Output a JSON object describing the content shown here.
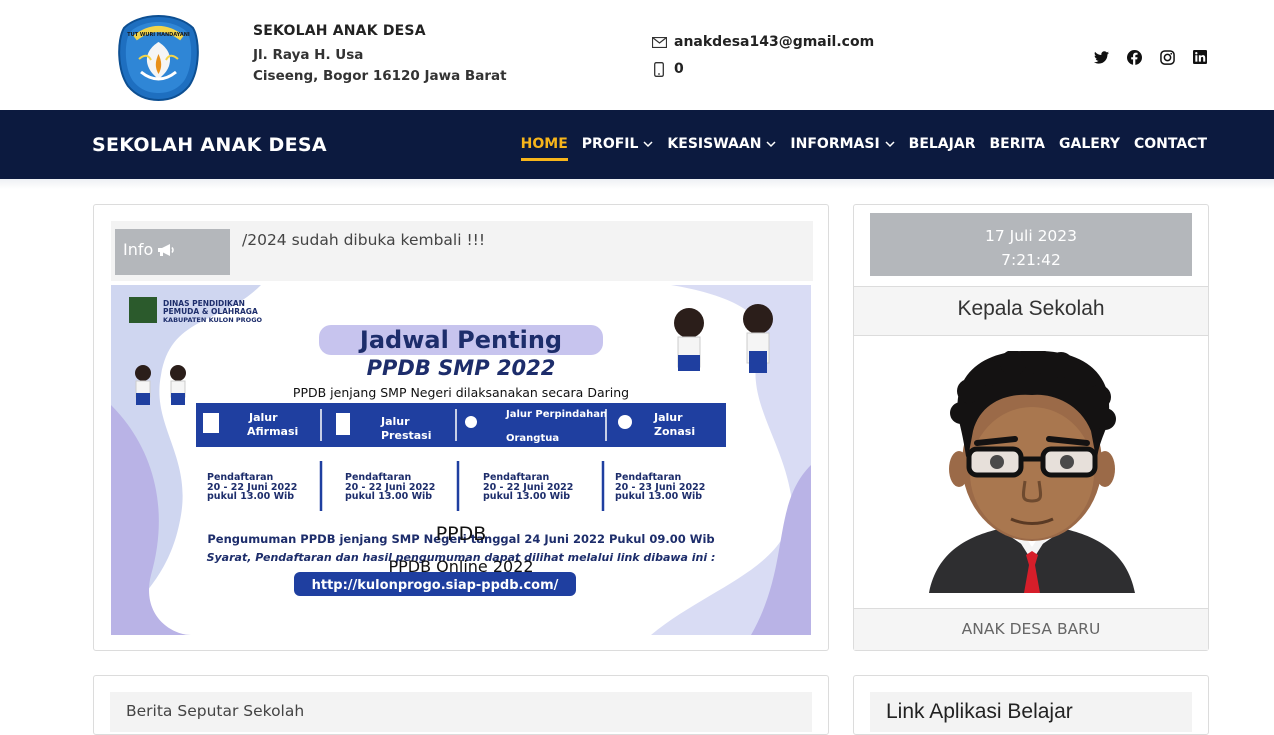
{
  "header": {
    "school_name": "SEKOLAH ANAK DESA",
    "address_line1": "Jl. Raya H. Usa",
    "address_line2": "Ciseeng, Bogor 16120 Jawa Barat",
    "email": "anakdesa143@gmail.com",
    "phone": "0",
    "logo_text": "TUT WURI HANDAYANI",
    "socials": [
      "twitter-icon",
      "facebook-icon",
      "instagram-icon",
      "linkedin-icon"
    ]
  },
  "navbar": {
    "brand": "SEKOLAH ANAK DESA",
    "items": [
      {
        "label": "HOME",
        "active": true,
        "dropdown": false
      },
      {
        "label": "PROFIL",
        "active": false,
        "dropdown": true
      },
      {
        "label": "KESISWAAN",
        "active": false,
        "dropdown": true
      },
      {
        "label": "INFORMASI",
        "active": false,
        "dropdown": true
      },
      {
        "label": "BELAJAR",
        "active": false,
        "dropdown": false
      },
      {
        "label": "BERITA",
        "active": false,
        "dropdown": false
      },
      {
        "label": "GALERY",
        "active": false,
        "dropdown": false
      },
      {
        "label": "CONTACT",
        "active": false,
        "dropdown": false
      }
    ],
    "bg_color": "#0c1a3f",
    "active_color": "#f7b51b"
  },
  "info": {
    "label": "Info",
    "text": "/2024 sudah dibuka kembali !!!"
  },
  "banner": {
    "org_line1": "DINAS PENDIDIKAN",
    "org_line2": "PEMUDA & OLAHRAGA",
    "org_line3": "KABUPATEN KULON PROGO",
    "title": "Jadwal Penting",
    "subtitle": "PPDB SMP 2022",
    "intro": "PPDB jenjang SMP Negeri dilaksanakan secara Daring",
    "paths": [
      {
        "line1": "Jalur",
        "line2": "Afirmasi",
        "reg": "20 - 22 Juni 2022"
      },
      {
        "line1": "Jalur",
        "line2": "Prestasi",
        "reg": "20 - 22 Juni 2022"
      },
      {
        "line1": "Jalur Perpindahan",
        "line2": "Orangtua",
        "reg": "20 - 22 Juni 2022"
      },
      {
        "line1": "Jalur",
        "line2": "Zonasi",
        "reg": "20 - 23 Juni 2022"
      }
    ],
    "reg_label": "Pendaftaran",
    "reg_time": "pukul 13.00 Wib",
    "announcement": "Pengumuman PPDB jenjang SMP Negeri tanggal 24 Juni 2022 Pukul 09.00 Wib",
    "requirements": "Syarat, Pendaftaran dan hasil pengumuman dapat dilihat melalui link dibawa ini :",
    "link": "http://kulonprogo.siap-ppdb.com/",
    "caption_title": "PPDB",
    "caption_sub": "PPDB Online 2022"
  },
  "sidebar": {
    "date": "17 Juli 2023",
    "time": "7:21:42",
    "kepala_title": "Kepala Sekolah",
    "kepala_name": "ANAK DESA BARU"
  },
  "bottom": {
    "left_title": "Berita Seputar Sekolah",
    "right_title": "Link Aplikasi Belajar"
  }
}
